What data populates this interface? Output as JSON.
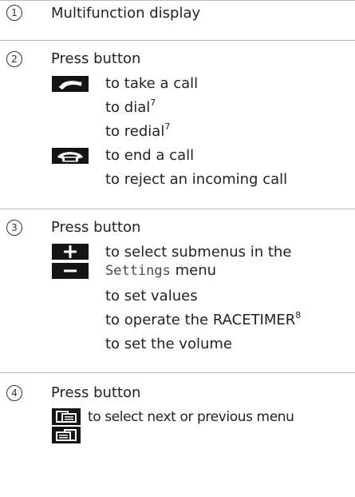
{
  "rows": [
    {
      "number": "1",
      "title": "Multifunction display"
    },
    {
      "number": "2",
      "title": "Press button",
      "entries": [
        {
          "text": "to take a call"
        },
        {
          "text": "to dial",
          "sup": "7"
        },
        {
          "text": "to redial",
          "sup": "7"
        },
        {
          "text": "to end a call"
        },
        {
          "text": "to reject an incoming call"
        }
      ]
    },
    {
      "number": "3",
      "title": "Press button",
      "entries": [
        {
          "text": "to select submenus in the"
        },
        {
          "mono": "Settings",
          "text": " menu"
        },
        {
          "text": "to set values"
        },
        {
          "text": "to operate the RACETIMER",
          "sup": "8"
        },
        {
          "text": "to set the volume"
        }
      ]
    },
    {
      "number": "4",
      "title": "Press button",
      "entries": [
        {
          "text": "to select next or previous menu"
        }
      ]
    }
  ],
  "icons": {
    "take_call": "phone-pickup-icon",
    "end_call": "phone-hangup-icon",
    "plus": "plus-icon",
    "minus": "minus-icon",
    "next_menu": "next-menu-icon",
    "prev_menu": "previous-menu-icon"
  }
}
